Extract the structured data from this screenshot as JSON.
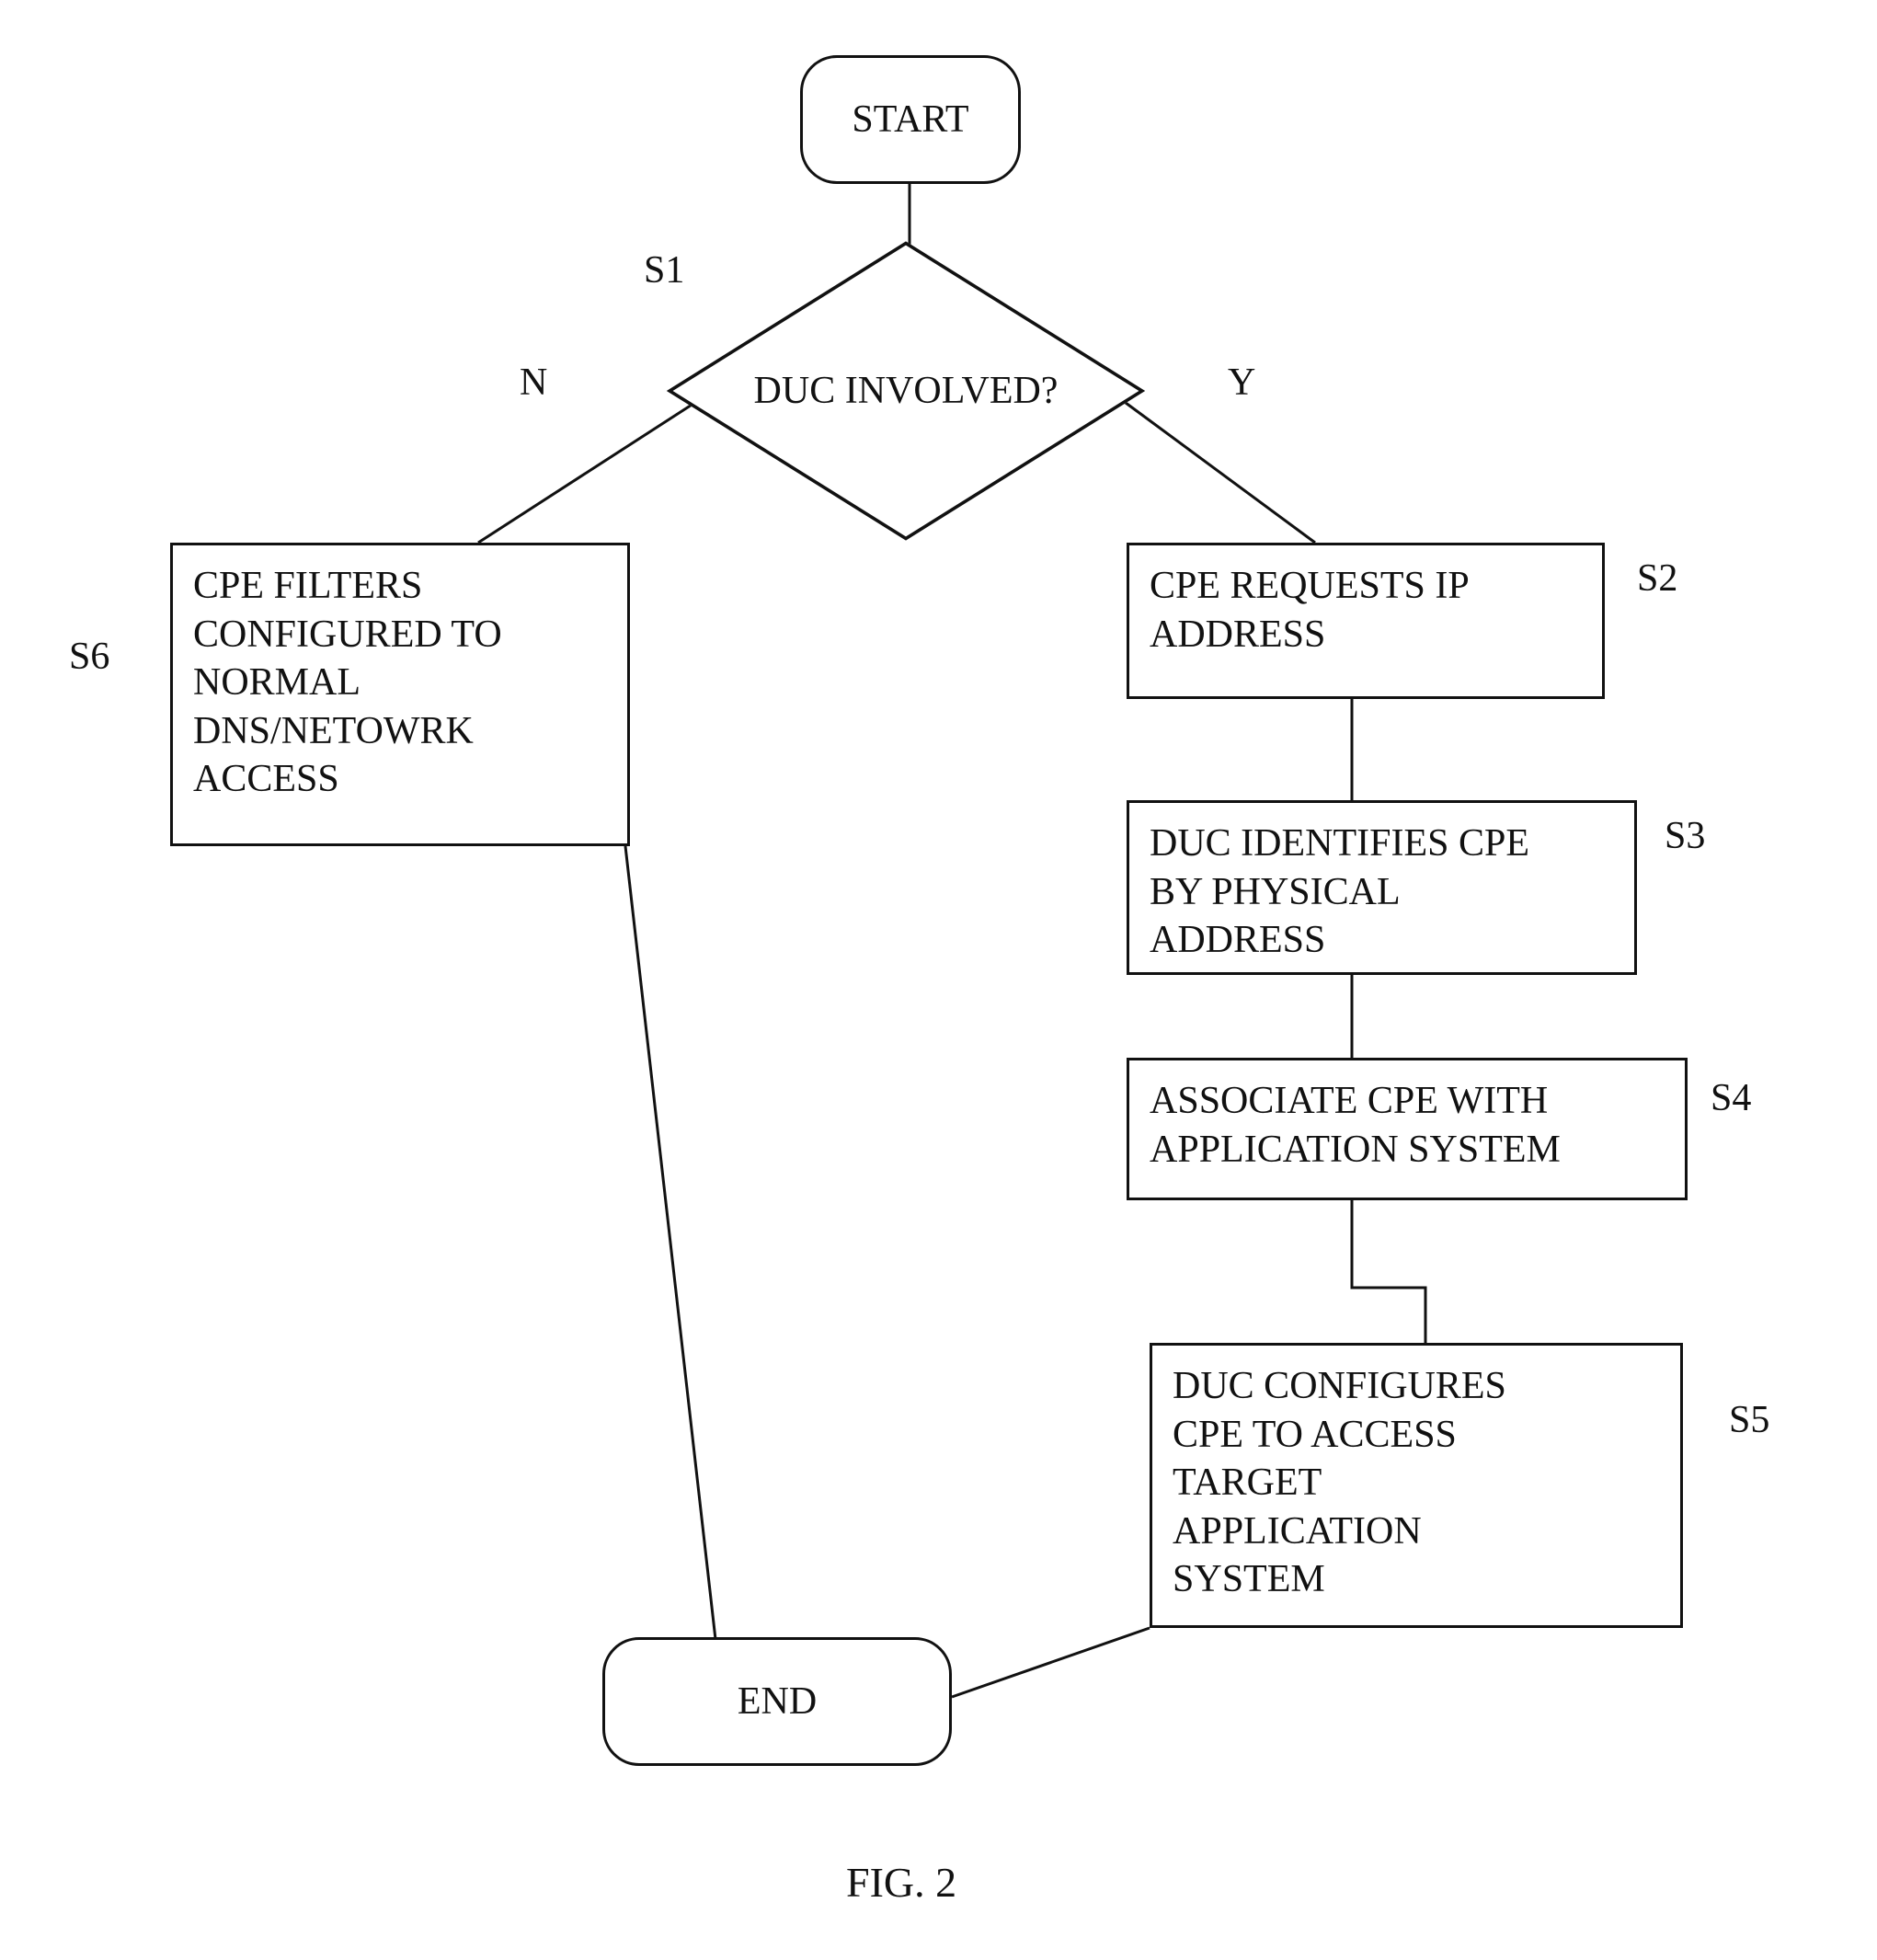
{
  "nodes": {
    "start": "START",
    "decision": "DUC INVOLVED?",
    "s1": "S1",
    "s2": "S2",
    "s3": "S3",
    "s4": "S4",
    "s5": "S5",
    "s6": "S6",
    "box_s6": "CPE FILTERS\nCONFIGURED TO\nNORMAL\nDNS/NETOWRK\nACCESS",
    "box_s2": "CPE REQUESTS IP\nADDRESS",
    "box_s3": "DUC IDENTIFIES CPE\nBY PHYSICAL\nADDRESS",
    "box_s4": "ASSOCIATE CPE WITH\nAPPLICATION SYSTEM",
    "box_s5": "DUC CONFIGURES\nCPE TO ACCESS\nTARGET\nAPPLICATION\nSYSTEM",
    "end": "END",
    "branch_no": "N",
    "branch_yes": "Y",
    "figure": "FIG. 2"
  }
}
